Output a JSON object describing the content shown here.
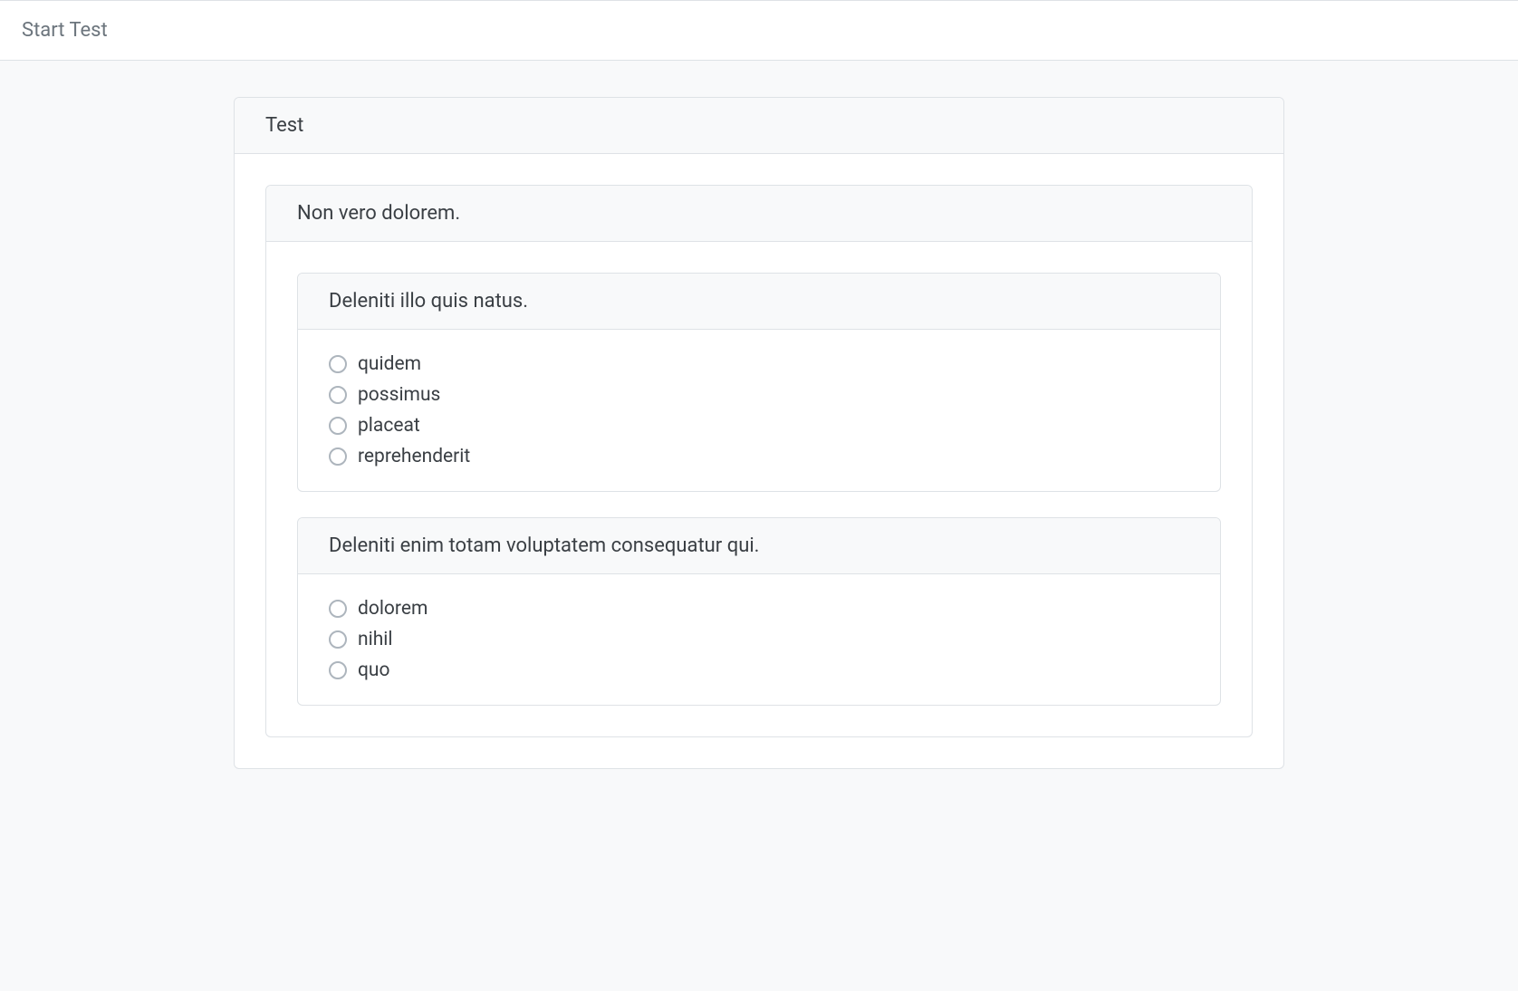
{
  "topbar": {
    "title": "Start Test"
  },
  "card": {
    "title": "Test"
  },
  "section": {
    "title": "Non vero dolorem."
  },
  "questions": [
    {
      "prompt": "Deleniti illo quis natus.",
      "options": [
        "quidem",
        "possimus",
        "placeat",
        "reprehenderit"
      ]
    },
    {
      "prompt": "Deleniti enim totam voluptatem consequatur qui.",
      "options": [
        "dolorem",
        "nihil",
        "quo"
      ]
    }
  ]
}
